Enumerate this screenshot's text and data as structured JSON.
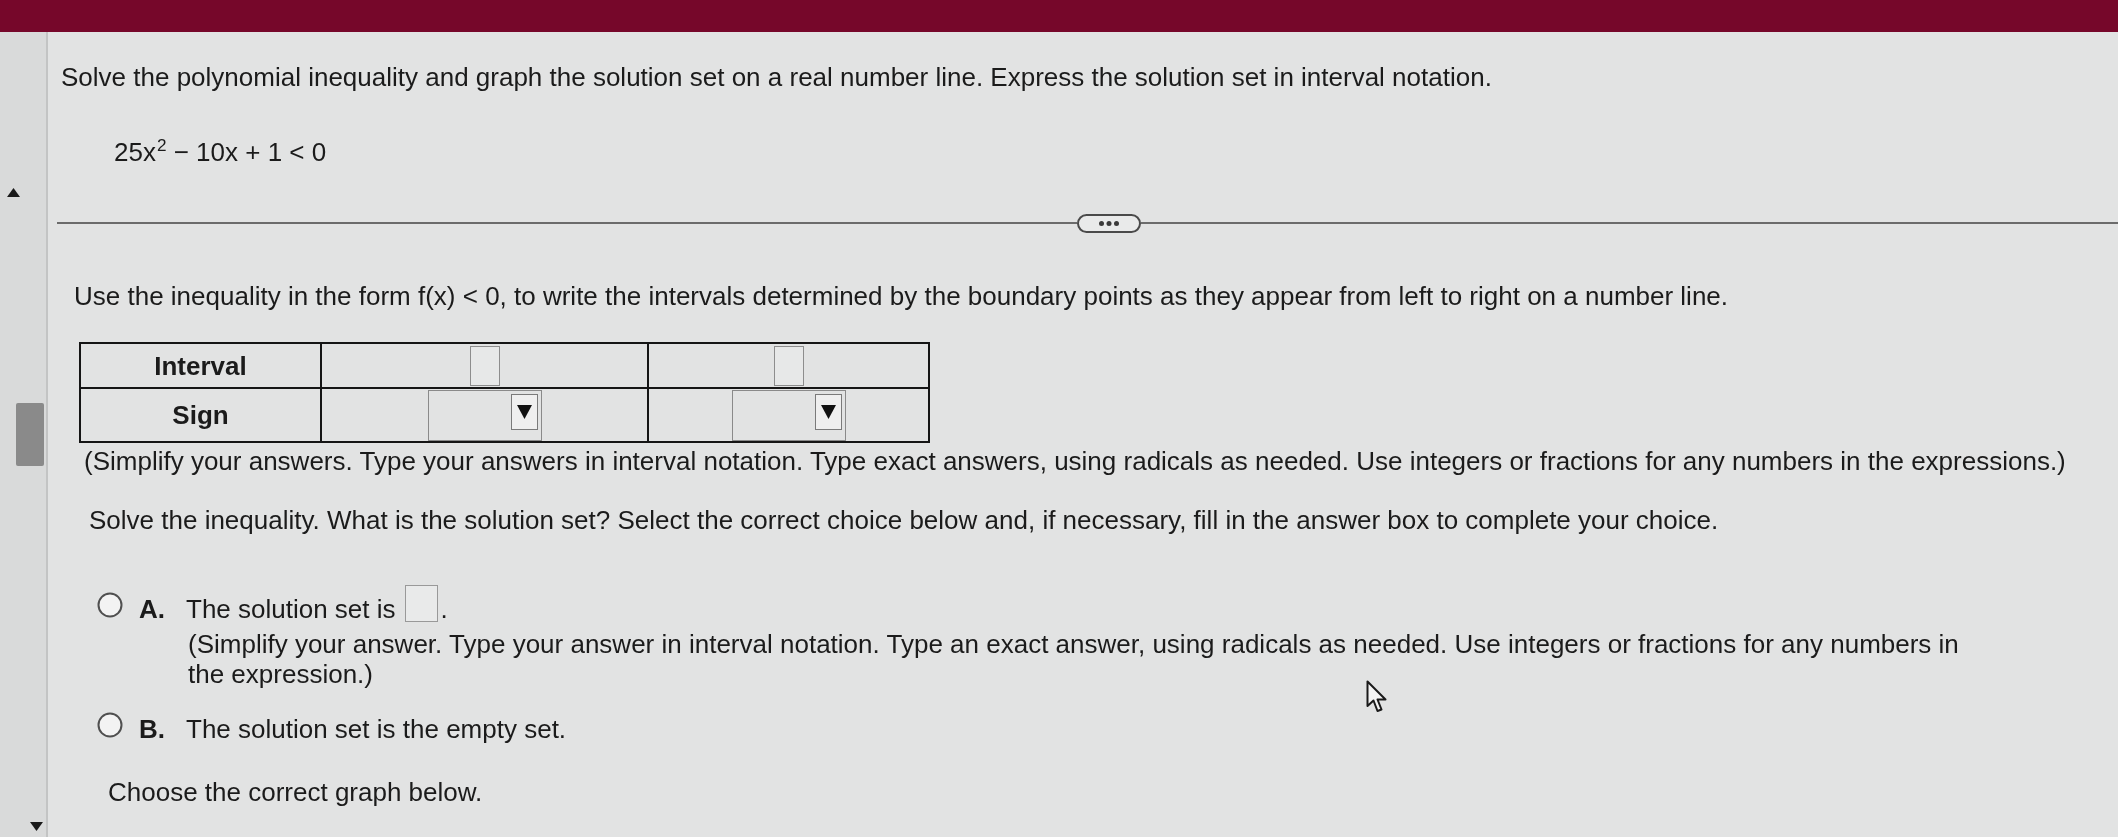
{
  "problem": {
    "instruction": "Solve the polynomial inequality and graph the solution set on a real number line. Express the solution set in interval notation.",
    "inequality": "25x$^{2}$ − 10x + 1 < 0"
  },
  "step": {
    "prompt": "Use the inequality in the form f(x) < 0, to write the intervals determined by the boundary points as they appear from left to right on a number line.",
    "table": {
      "rows": [
        {
          "header": "Interval",
          "cells": [
            {
              "kind": "answer_box"
            },
            {
              "kind": "answer_box"
            }
          ]
        },
        {
          "header": "Sign",
          "cells": [
            {
              "kind": "dropdown"
            },
            {
              "kind": "dropdown"
            }
          ]
        }
      ]
    },
    "note": "(Simplify your answers. Type your answers in interval notation. Type exact answers, using radicals as needed. Use integers or fractions for any numbers in the expressions.)"
  },
  "solution": {
    "prompt": "Solve the inequality. What is the solution set? Select the correct choice below and, if necessary, fill in the answer box to complete your choice.",
    "choices": [
      {
        "kind": "with_box",
        "letter": "A.",
        "text": "The solution set is",
        "after_box": ".",
        "note": "(Simplify your answer. Type your answer in interval notation. Type an exact answer, using radicals as needed. Use integers or fractions for any numbers in the expression.)",
        "selected": false
      },
      {
        "kind": "plain",
        "letter": "B.",
        "text": "The solution set is the empty set.",
        "selected": false
      }
    ]
  },
  "graph": {
    "prompt": "Choose the correct graph below."
  }
}
